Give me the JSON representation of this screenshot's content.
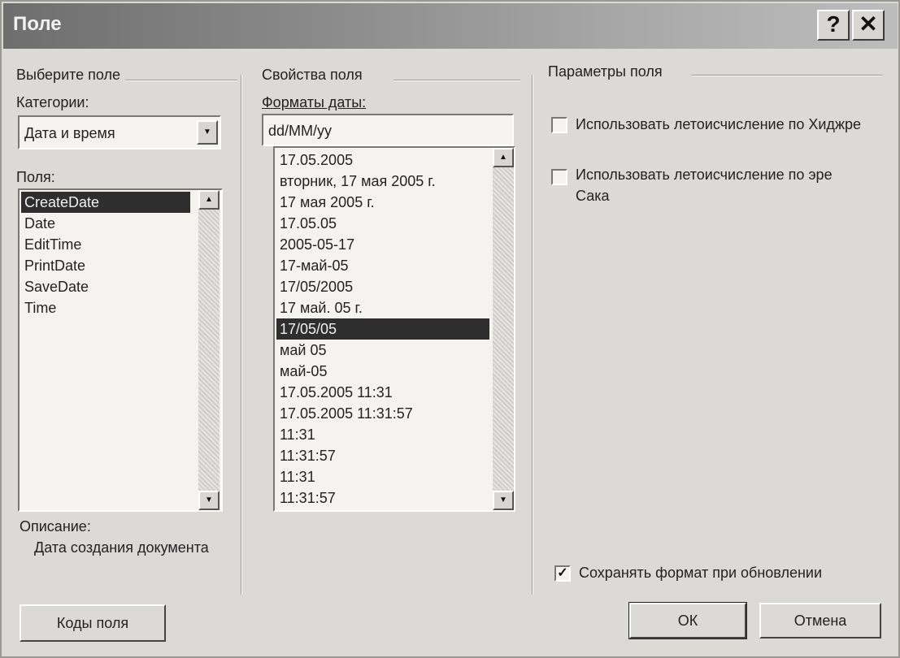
{
  "window": {
    "title": "Поле",
    "help_glyph": "?",
    "close_glyph": "✕"
  },
  "left": {
    "group_title": "Выберите поле",
    "categories_label": "Категории:",
    "category_value": "Дата и время",
    "fields_label": "Поля:",
    "fields": [
      "CreateDate",
      "Date",
      "EditTime",
      "PrintDate",
      "SaveDate",
      "Time"
    ],
    "selected_field": "CreateDate",
    "description_label": "Описание:",
    "description_text": "Дата создания документа"
  },
  "middle": {
    "group_title": "Свойства поля",
    "formats_label": "Форматы даты:",
    "format_value": "dd/MM/yy",
    "formats": [
      "17.05.2005",
      "вторник, 17 мая 2005 г.",
      "17 мая 2005 г.",
      "17.05.05",
      "2005-05-17",
      "17-май-05",
      "17/05/2005",
      "17 май. 05 г.",
      "17/05/05",
      "май 05",
      "май-05",
      "17.05.2005 11:31",
      "17.05.2005 11:31:57",
      "11:31",
      "11:31:57",
      "11:31",
      "11:31:57"
    ],
    "selected_format": "17/05/05"
  },
  "right": {
    "group_title": "Параметры поля",
    "option1": {
      "label": "Использовать летоисчисление по Хиджре",
      "checked": false
    },
    "option2": {
      "label": "Использовать летоисчисление по эре Сака",
      "checked": false
    },
    "preserve": {
      "label": "Сохранять формат при обновлении",
      "checked": true,
      "check_glyph": "✓"
    }
  },
  "buttons": {
    "field_codes": "Коды поля",
    "ok": "ОК",
    "cancel": "Отмена"
  },
  "icons": {
    "dropdown": "▼",
    "scroll_up": "▲",
    "scroll_down": "▼"
  }
}
